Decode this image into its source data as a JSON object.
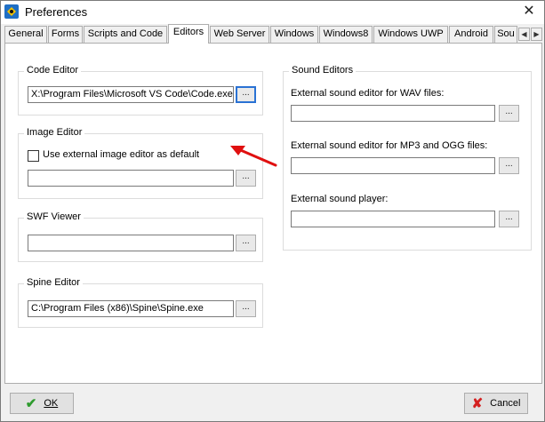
{
  "window": {
    "title": "Preferences",
    "close_glyph": "✕"
  },
  "tabs": [
    {
      "label": "General"
    },
    {
      "label": "Forms"
    },
    {
      "label": "Scripts and Code"
    },
    {
      "label": "Editors",
      "active": true
    },
    {
      "label": "Web Server"
    },
    {
      "label": "Windows"
    },
    {
      "label": "Windows8"
    },
    {
      "label": "Windows UWP"
    },
    {
      "label": "Android"
    },
    {
      "label": "Sou"
    }
  ],
  "tab_scroll": {
    "left": "◀",
    "right": "▶"
  },
  "code_editor": {
    "group_label": "Code Editor",
    "path": "X:\\Program Files\\Microsoft VS Code\\Code.exe",
    "browse_label": "..."
  },
  "image_editor": {
    "group_label": "Image Editor",
    "checkbox_label": "Use external image editor as default",
    "checked": false,
    "path": "",
    "browse_label": "..."
  },
  "swf_viewer": {
    "group_label": "SWF Viewer",
    "path": "",
    "browse_label": "..."
  },
  "spine_editor": {
    "group_label": "Spine Editor",
    "path": "C:\\Program Files (x86)\\Spine\\Spine.exe",
    "browse_label": "..."
  },
  "sound_editors": {
    "group_label": "Sound Editors",
    "wav_label": "External sound editor for WAV files:",
    "wav_path": "",
    "mp3_label": "External sound editor for MP3 and OGG files:",
    "mp3_path": "",
    "player_label": "External sound player:",
    "player_path": "",
    "browse_label": "..."
  },
  "footer": {
    "ok_label": "OK",
    "cancel_label": "Cancel",
    "ok_icon": "✔",
    "cancel_icon": "✘"
  },
  "colors": {
    "ok_icon": "#2e9b2e",
    "cancel_icon": "#d42020",
    "annotation_arrow": "#e01010",
    "focus_border": "#2a72d4"
  }
}
